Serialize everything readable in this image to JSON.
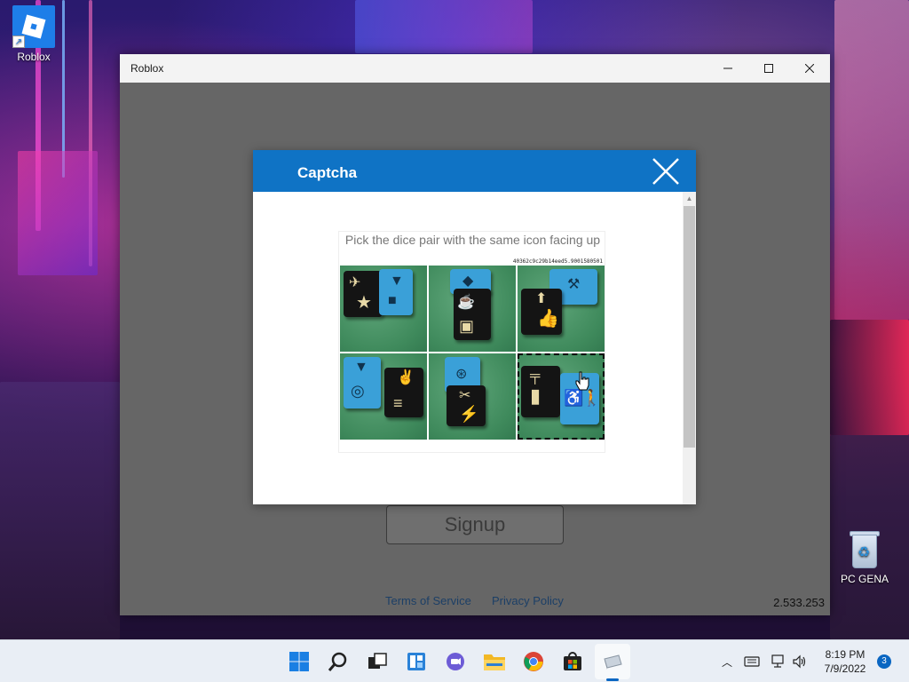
{
  "desktop": {
    "icons": [
      {
        "label": "Roblox",
        "icon": "roblox-icon"
      },
      {
        "label": "PC GENA",
        "icon": "recycle-bin-icon"
      }
    ]
  },
  "window": {
    "title": "Roblox",
    "controls": {
      "minimize": "minimize-icon",
      "maximize": "maximize-icon",
      "close": "close-icon"
    }
  },
  "app": {
    "signup_label": "Signup",
    "terms_label": "Terms of Service",
    "privacy_label": "Privacy Policy",
    "version": "2.533.253"
  },
  "captcha": {
    "title": "Captcha",
    "prompt": "Pick the dice pair with the same icon facing up",
    "hash": "40362c9c29b14eed5.9001580501",
    "selected_cell": 6,
    "cells": [
      1,
      2,
      3,
      4,
      5,
      6
    ]
  },
  "taskbar": {
    "apps": [
      "windows-start-icon",
      "search-icon",
      "task-view-icon",
      "widgets-icon",
      "chat-icon",
      "file-explorer-icon",
      "chrome-icon",
      "store-icon",
      "roblox-app-icon"
    ],
    "tray": {
      "time": "8:19 PM",
      "date": "7/9/2022",
      "notifications": "3"
    }
  },
  "colors": {
    "captcha_header": "#0f73c5",
    "taskbar_bg": "#e9eef5",
    "accent": "#0a66c2"
  }
}
